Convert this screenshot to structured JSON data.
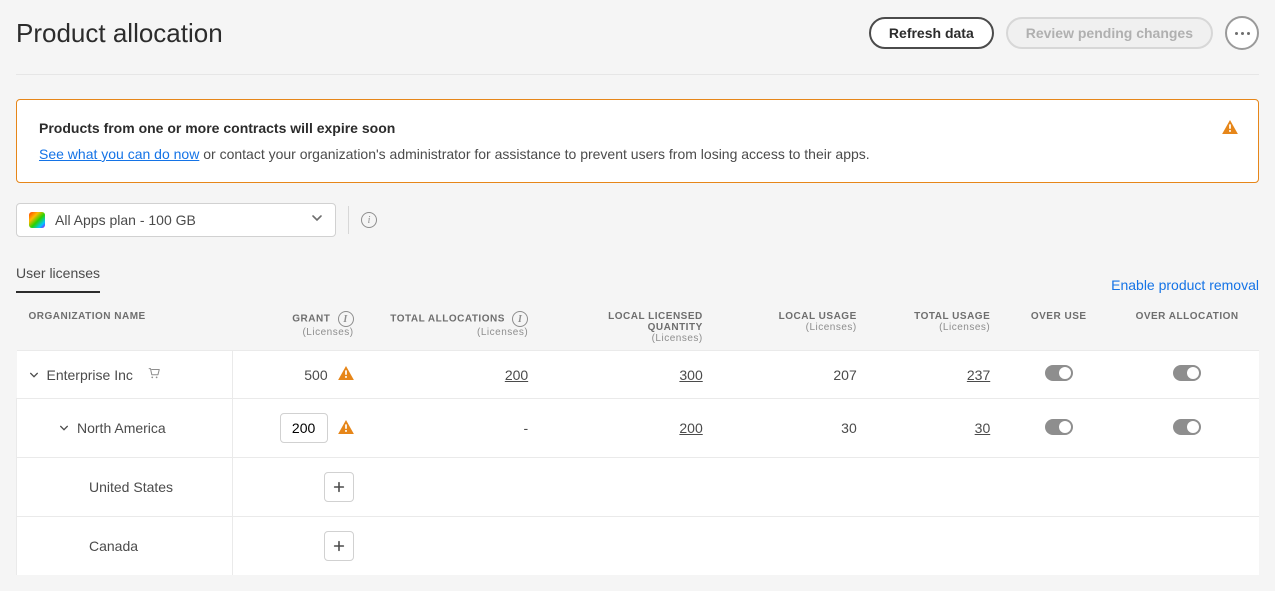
{
  "header": {
    "title": "Product allocation",
    "refresh_label": "Refresh data",
    "review_label": "Review pending changes"
  },
  "alert": {
    "title": "Products from one or more contracts will expire soon",
    "link_text": "See what you can do now",
    "rest_text": " or contact your organization's administrator for assistance to prevent users from losing access to their apps."
  },
  "product_select": {
    "label": "All Apps plan - 100 GB"
  },
  "tabs": {
    "licenses_label": "User licenses",
    "enable_removal": "Enable product removal"
  },
  "columns": {
    "org": "ORGANIZATION NAME",
    "grant": "GRANT",
    "grant_sub": "(Licenses)",
    "total_alloc": "TOTAL ALLOCATIONS",
    "total_alloc_sub": "(Licenses)",
    "local_lic": "LOCAL LICENSED QUANTITY",
    "local_lic_sub": "(Licenses)",
    "local_usage": "LOCAL USAGE",
    "local_usage_sub": "(Licenses)",
    "total_usage": "TOTAL USAGE",
    "total_usage_sub": "(Licenses)",
    "over_use": "OVER USE",
    "over_alloc": "OVER ALLOCATION"
  },
  "rows": [
    {
      "name": "Enterprise Inc",
      "indent": 0,
      "cart": true,
      "grant": "500",
      "grant_editable": false,
      "warn": true,
      "total_alloc": "200",
      "local_lic": "300",
      "local_usage": "207",
      "total_usage": "237",
      "over_use": true,
      "over_alloc": true
    },
    {
      "name": "North America",
      "indent": 1,
      "cart": false,
      "grant": "200",
      "grant_editable": true,
      "warn": true,
      "total_alloc": "-",
      "local_lic": "200",
      "local_usage": "30",
      "total_usage": "30",
      "over_use": true,
      "over_alloc": true
    },
    {
      "name": "United States",
      "indent": 2,
      "cart": false,
      "grant": "",
      "grant_editable": "add",
      "warn": false,
      "total_alloc": "",
      "local_lic": "",
      "local_usage": "",
      "total_usage": "",
      "over_use": null,
      "over_alloc": null
    },
    {
      "name": "Canada",
      "indent": 2,
      "cart": false,
      "grant": "",
      "grant_editable": "add",
      "warn": false,
      "total_alloc": "",
      "local_lic": "",
      "local_usage": "",
      "total_usage": "",
      "over_use": null,
      "over_alloc": null
    }
  ]
}
